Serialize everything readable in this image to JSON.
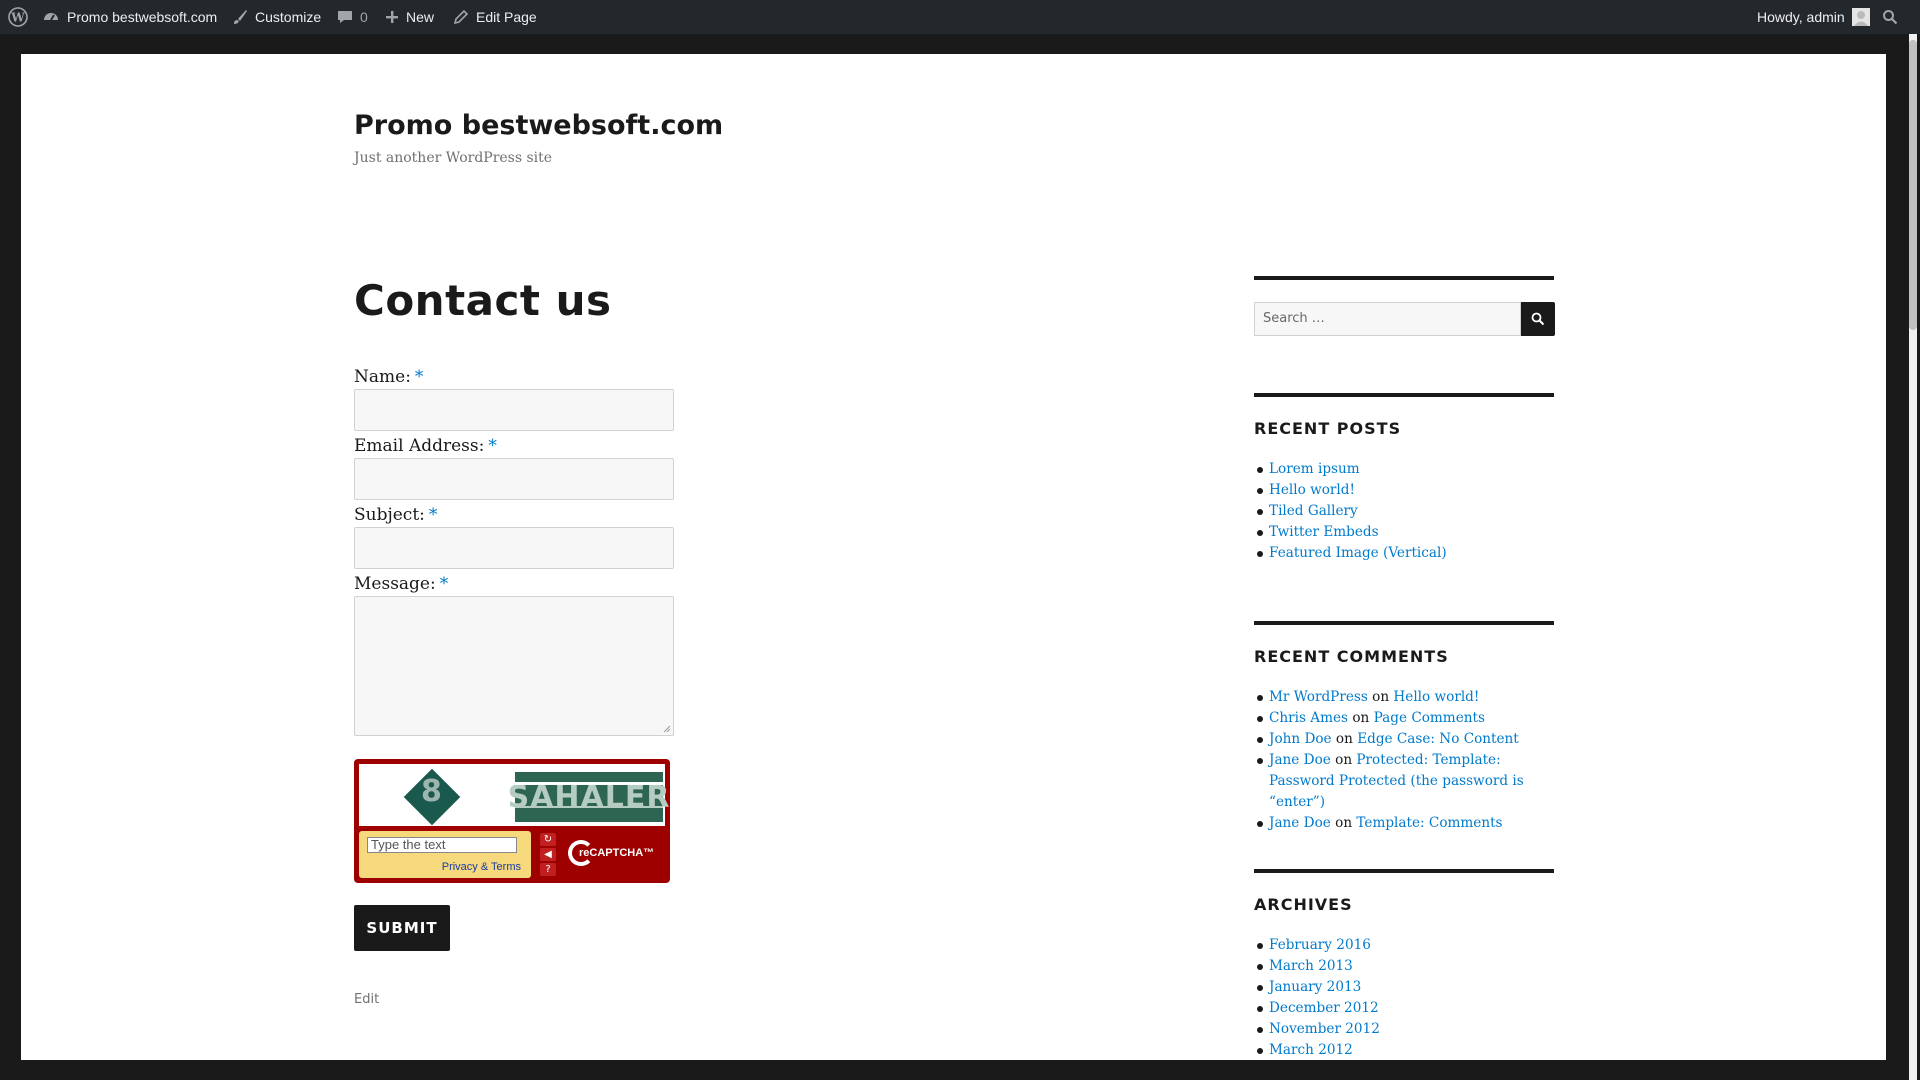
{
  "adminbar": {
    "site_name": "Promo bestwebsoft.com",
    "customize": "Customize",
    "comments_count": "0",
    "new": "New",
    "edit_page": "Edit Page",
    "howdy": "Howdy, admin"
  },
  "site": {
    "title": "Promo bestwebsoft.com",
    "description": "Just another WordPress site"
  },
  "page_title": "Contact us",
  "form": {
    "name_label": "Name:",
    "email_label": "Email Address:",
    "subject_label": "Subject:",
    "message_label": "Message:",
    "required_mark": "*",
    "captcha": {
      "digit": "8",
      "word": "SAHALER",
      "input_placeholder": "Type the text",
      "privacy_link": "Privacy & Terms",
      "brand": "reCAPTCHA™"
    },
    "submit_label": "SUBMIT"
  },
  "edit_link": "Edit",
  "sidebar": {
    "search_placeholder": "Search …",
    "recent_posts_title": "RECENT POSTS",
    "recent_posts": [
      "Lorem ipsum",
      "Hello world!",
      "Tiled Gallery",
      "Twitter Embeds",
      "Featured Image (Vertical)"
    ],
    "recent_comments_title": "RECENT COMMENTS",
    "recent_comments": [
      {
        "author": "Mr WordPress",
        "on": "on",
        "post": "Hello world!"
      },
      {
        "author": "Chris Ames",
        "on": "on",
        "post": "Page Comments"
      },
      {
        "author": "John Doe",
        "on": "on",
        "post": "Edge Case: No Content"
      },
      {
        "author": "Jane Doe",
        "on": "on",
        "post": "Protected: Template: Password Protected (the password is “enter”)"
      },
      {
        "author": "Jane Doe",
        "on": "on",
        "post": "Template: Comments"
      }
    ],
    "archives_title": "ARCHIVES",
    "archives": [
      "February 2016",
      "March 2013",
      "January 2013",
      "December 2012",
      "November 2012",
      "March 2012"
    ]
  },
  "colors": {
    "admin_bar": "#23282d",
    "link": "#007acc",
    "required": "#007acc",
    "text": "#1a1a1a",
    "captcha_bg": "#9e0000"
  }
}
